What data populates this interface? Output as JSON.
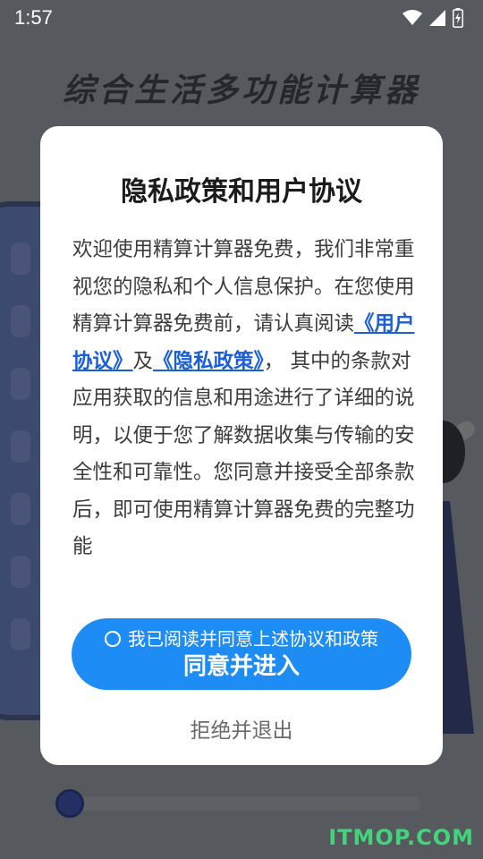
{
  "status_bar": {
    "time": "1:57",
    "icons": [
      "wifi-icon",
      "cellular-signal-icon",
      "battery-charging-icon"
    ]
  },
  "background": {
    "app_title": "综合生活多功能计算器",
    "slider_value": 0.02
  },
  "dialog": {
    "title": "隐私政策和用户协议",
    "body": {
      "part1": "欢迎使用精算计算器免费，我们非常重视您的隐私和个人信息保护。在您使用精算计算器免费前，请认真阅读",
      "user_agreement_link": "《用户协议》",
      "part2": "及",
      "privacy_policy_link": "《隐私政策》",
      "part3": "， 其中的条款对应用获取的信息和用途进行了详细的说明，以便于您了解数据收集与传输的安全性和可靠性。您同意并接受全部条款后，即可使用精算计算器免费的完整功能"
    },
    "agree_checkbox_label": "我已阅读并同意上述协议和政策",
    "agree_checkbox_checked": false,
    "agree_button_label": "同意并进入",
    "refuse_button_label": "拒绝并退出"
  },
  "watermark": "ITMOP.COM",
  "colors": {
    "accent": "#1e8cf5",
    "link": "#1a5edb",
    "watermark": "#43d37d"
  }
}
